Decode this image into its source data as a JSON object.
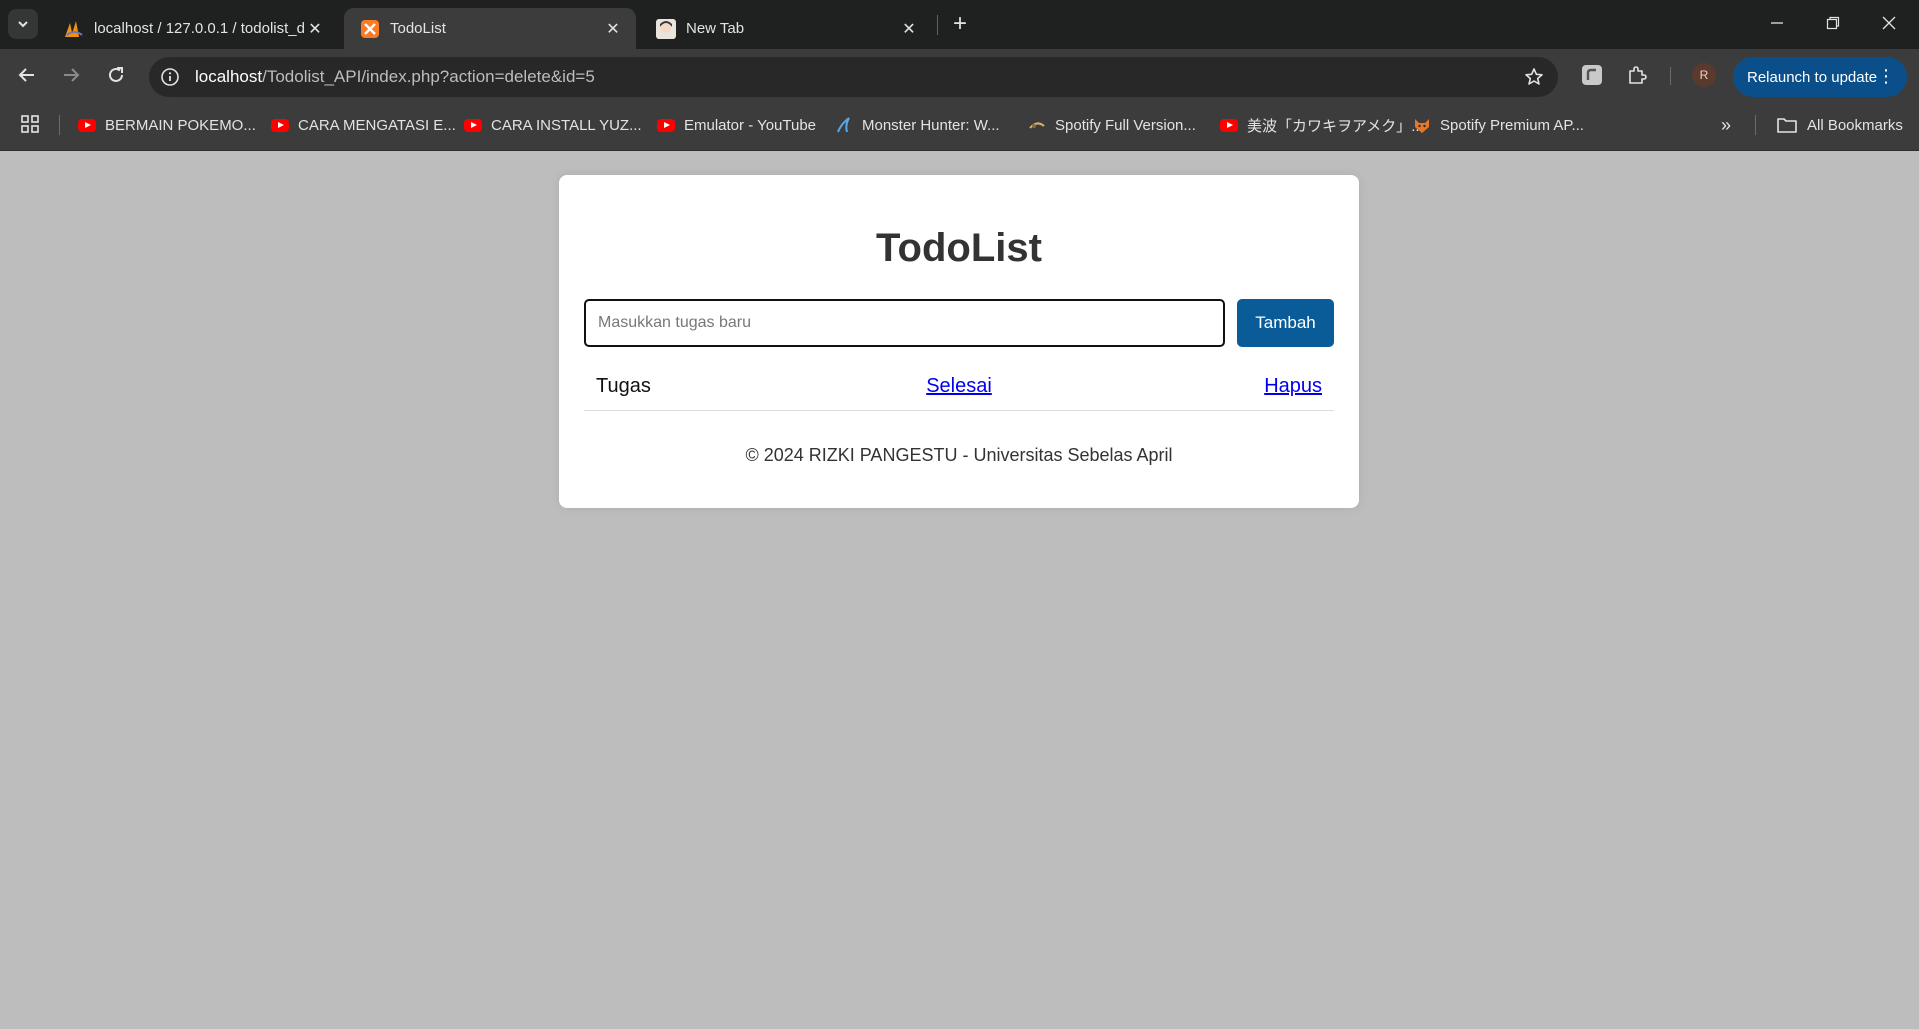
{
  "browser": {
    "tabs": [
      {
        "title": "localhost / 127.0.0.1 / todolist_d",
        "icon": "phpmyadmin-icon",
        "active": false
      },
      {
        "title": "TodoList",
        "icon": "xampp-icon",
        "active": true
      },
      {
        "title": "New Tab",
        "icon": "anime-avatar-icon",
        "active": false
      }
    ],
    "url_host": "localhost",
    "url_path": "/Todolist_API/index.php?action=delete&id=5",
    "profile_initial": "R",
    "relaunch_label": "Relaunch to update",
    "accent_color": "#0b4f8a",
    "bookmarks": [
      {
        "label": "BERMAIN POKEMO...",
        "icon": "youtube-icon"
      },
      {
        "label": "CARA MENGATASI E...",
        "icon": "youtube-icon"
      },
      {
        "label": "CARA INSTALL YUZ...",
        "icon": "youtube-icon"
      },
      {
        "label": "Emulator - YouTube",
        "icon": "youtube-icon"
      },
      {
        "label": "Monster Hunter: W...",
        "icon": "monster-hunter-icon"
      },
      {
        "label": "Spotify Full Version...",
        "icon": "spotify-site-icon"
      },
      {
        "label": "美波「カワキヲアメク」...",
        "icon": "youtube-icon"
      },
      {
        "label": "Spotify Premium AP...",
        "icon": "fox-icon"
      }
    ],
    "all_bookmarks_label": "All Bookmarks"
  },
  "app": {
    "title": "TodoList",
    "input_placeholder": "Masukkan tugas baru",
    "input_value": "",
    "add_button_label": "Tambah",
    "primary_color": "#0a5c99",
    "tasks": [
      {
        "name": "Tugas",
        "done_label": "Selesai",
        "delete_label": "Hapus"
      }
    ],
    "footer": "© 2024 RIZKI PANGESTU - Universitas Sebelas April"
  }
}
